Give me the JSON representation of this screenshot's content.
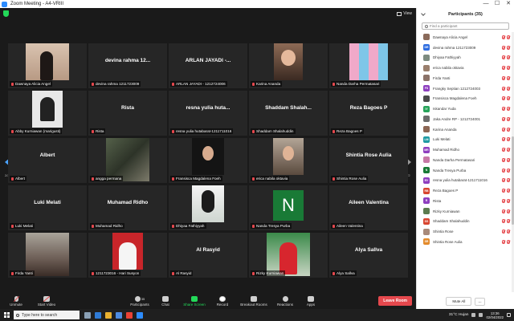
{
  "window": {
    "title": "Zoom Meeting - A4-VRIII",
    "minimize": "—",
    "maximize": "☐",
    "close": "✕"
  },
  "top": {
    "view_label": "View"
  },
  "pagination": {
    "left": "2/2",
    "right": "2/2"
  },
  "tiles": [
    {
      "label": "Dawnaya Alicia Angel",
      "big": "",
      "photo": "ph-girl1"
    },
    {
      "label": "devina rahma 1211723009",
      "big": "devina rahma 12...",
      "photo": ""
    },
    {
      "label": "ARLAN JAYADI - 1212724006",
      "big": "ARLAN JAYADI -...",
      "photo": ""
    },
    {
      "label": "Karina Ananda",
      "big": "",
      "photo": "ph-girl2"
    },
    {
      "label": "Nanda Darha Permatasari",
      "big": "",
      "photo": "ph-collage"
    },
    {
      "label": "Abby Kurniawan (marigusti)",
      "big": "",
      "photo": "ph-boy1"
    },
    {
      "label": "Rista",
      "big": "Rista",
      "photo": ""
    },
    {
      "label": "resna yulia hutabarat-1211711016",
      "big": "resna yulia huta...",
      "photo": ""
    },
    {
      "label": "Shaddam Shalahuddin",
      "big": "Shaddam Shalah...",
      "photo": ""
    },
    {
      "label": "Reza Bagoes P",
      "big": "Reza Bagoes P",
      "photo": ""
    },
    {
      "label": "Albert",
      "big": "Albert",
      "photo": ""
    },
    {
      "label": "angga permana",
      "big": "",
      "photo": "ph-forest"
    },
    {
      "label": "Fransisca Magdalena Foeh",
      "big": "",
      "photo": "ph-girl3"
    },
    {
      "label": "erica nabila oktavia",
      "big": "",
      "photo": "ph-girl4"
    },
    {
      "label": "Shintia Rose Aulia",
      "big": "Shintia Rose Aulia",
      "photo": ""
    },
    {
      "label": "Luki Melati",
      "big": "Luki Melati",
      "photo": ""
    },
    {
      "label": "Muhamad Ridho",
      "big": "Muhamad Ridho",
      "photo": ""
    },
    {
      "label": "Dhiyaa Fathiyyah",
      "big": "",
      "photo": "ph-hijab"
    },
    {
      "label": "Nanda Tresya Purba",
      "big": "",
      "photo": "ph-n",
      "initial": "N"
    },
    {
      "label": "Aileen Valentina",
      "big": "Aileen Valentina",
      "photo": ""
    },
    {
      "label": "Firda Yanti",
      "big": "",
      "photo": "ph-city"
    },
    {
      "label": "1211723016 - Hari Susyon",
      "big": "",
      "photo": "ph-boy2"
    },
    {
      "label": "Al Rasyid",
      "big": "Al Rasyid",
      "photo": ""
    },
    {
      "label": "Rizky Kurniawan",
      "big": "",
      "photo": "ph-rizky"
    },
    {
      "label": "Alya Sallva",
      "big": "Alya Sallva",
      "photo": ""
    }
  ],
  "toolbar": {
    "unmute": "Unmute",
    "start_video": "Start Video",
    "participants": "Participants",
    "participants_count": "35",
    "chat": "Chat",
    "share_screen": "Share Screen",
    "record": "Record",
    "breakout_rooms": "Breakout Rooms",
    "reactions": "Reactions",
    "apps": "Apps",
    "leave": "Leave Room"
  },
  "panel": {
    "title": "Participants (35)",
    "search_placeholder": "Find a participant",
    "mute_all": "Mute All",
    "more": "...",
    "participants": [
      {
        "name": "Dawnaya Alicia Angel",
        "initials": "",
        "color": "#8a6a5a"
      },
      {
        "name": "devina rahma 1211723009",
        "initials": "DR",
        "color": "#2d6cdf"
      },
      {
        "name": "Dhiyaa Fathiyyah",
        "initials": "",
        "color": "#7d8b80"
      },
      {
        "name": "erica nabila oktavia",
        "initials": "",
        "color": "#9a7f6d"
      },
      {
        "name": "Firda Yanti",
        "initials": "",
        "color": "#8b7268"
      },
      {
        "name": "Frangky Septian 1212724003",
        "initials": "FS",
        "color": "#8e3fbf"
      },
      {
        "name": "Fransisca Magdalena Foeh",
        "initials": "",
        "color": "#4a4a4a"
      },
      {
        "name": "Iskandar Yuda",
        "initials": "IY",
        "color": "#27a35a"
      },
      {
        "name": "Jaka Andre RP - 1212724001",
        "initials": "",
        "color": "#6c6c6c"
      },
      {
        "name": "Karina Ananda",
        "initials": "",
        "color": "#8c6654"
      },
      {
        "name": "Luki Melati",
        "initials": "LM",
        "color": "#1f9aa3"
      },
      {
        "name": "Muhamad Ridho",
        "initials": "MR",
        "color": "#8e3fbf"
      },
      {
        "name": "Nanda Darha Permatasari",
        "initials": "",
        "color": "#c779a6"
      },
      {
        "name": "Nanda Tresya Purba",
        "initials": "N",
        "color": "#197a36"
      },
      {
        "name": "resna yulia hutabarat-1211711016",
        "initials": "RY",
        "color": "#8e3fbf"
      },
      {
        "name": "Reza Bagoes P",
        "initials": "RB",
        "color": "#d8452f"
      },
      {
        "name": "Rista",
        "initials": "R",
        "color": "#8e3fbf"
      },
      {
        "name": "Rizky Kurniawan",
        "initials": "",
        "color": "#5c7c4f"
      },
      {
        "name": "Shaddam Shalahuddin",
        "initials": "SS",
        "color": "#d8452f"
      },
      {
        "name": "Shintia Rose",
        "initials": "",
        "color": "#a88a7a"
      },
      {
        "name": "Shintia Rose Aulia",
        "initials": "SR",
        "color": "#e38b2c"
      }
    ]
  },
  "taskbar": {
    "search_placeholder": "Type here to search",
    "weather": "31°C Hujan",
    "time": "13:36",
    "date": "02/04/2022"
  },
  "colors": {
    "accent": "#2d8cff",
    "leave": "#e5484d",
    "share": "#23d959",
    "muted": "#e5484d"
  }
}
